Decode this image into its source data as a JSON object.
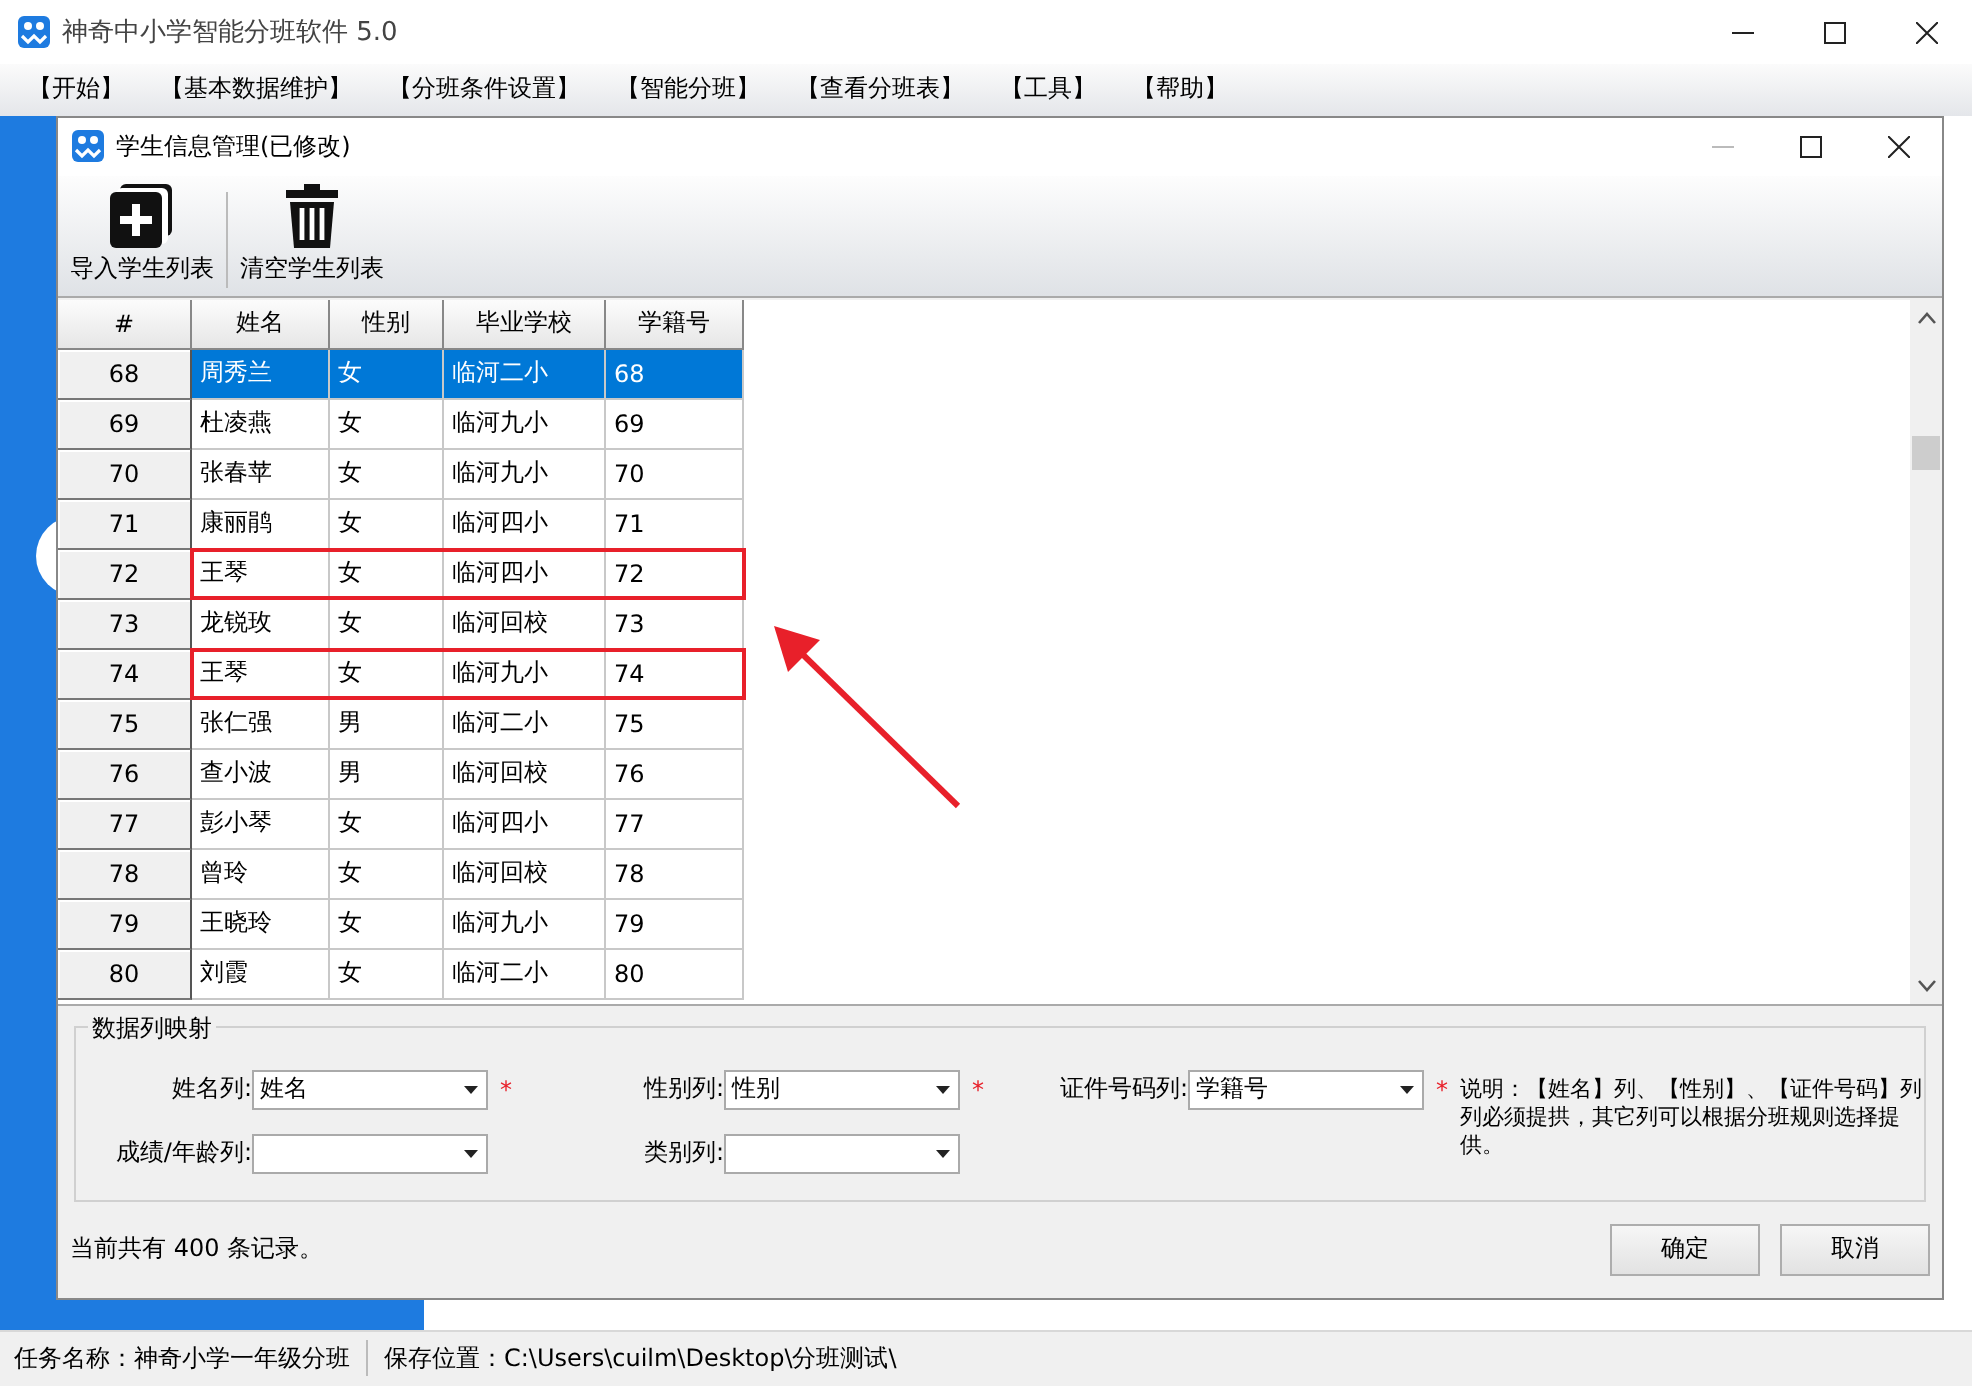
{
  "window": {
    "title": "神奇中小学智能分班软件 5.0"
  },
  "menu": [
    "【开始】",
    "【基本数据维护】",
    "【分班条件设置】",
    "【智能分班】",
    "【查看分班表】",
    "【工具】",
    "【帮助】"
  ],
  "dialog": {
    "title": "学生信息管理(已修改)",
    "toolbar": [
      {
        "kind": "import",
        "label": "导入学生列表"
      },
      {
        "kind": "clear",
        "label": "清空学生列表"
      }
    ],
    "table": {
      "columns": [
        "#",
        "姓名",
        "性别",
        "毕业学校",
        "学籍号"
      ],
      "rows": [
        {
          "cells": [
            "68",
            "周秀兰",
            "女",
            "临河二小",
            "68"
          ],
          "selected": true,
          "highlighted": false
        },
        {
          "cells": [
            "69",
            "杜凌燕",
            "女",
            "临河九小",
            "69"
          ],
          "selected": false,
          "highlighted": false
        },
        {
          "cells": [
            "70",
            "张春苹",
            "女",
            "临河九小",
            "70"
          ],
          "selected": false,
          "highlighted": false
        },
        {
          "cells": [
            "71",
            "康丽鹃",
            "女",
            "临河四小",
            "71"
          ],
          "selected": false,
          "highlighted": false
        },
        {
          "cells": [
            "72",
            "王琴",
            "女",
            "临河四小",
            "72"
          ],
          "selected": false,
          "highlighted": true
        },
        {
          "cells": [
            "73",
            "龙锐玫",
            "女",
            "临河回校",
            "73"
          ],
          "selected": false,
          "highlighted": false
        },
        {
          "cells": [
            "74",
            "王琴",
            "女",
            "临河九小",
            "74"
          ],
          "selected": false,
          "highlighted": true
        },
        {
          "cells": [
            "75",
            "张仁强",
            "男",
            "临河二小",
            "75"
          ],
          "selected": false,
          "highlighted": false
        },
        {
          "cells": [
            "76",
            "查小波",
            "男",
            "临河回校",
            "76"
          ],
          "selected": false,
          "highlighted": false
        },
        {
          "cells": [
            "77",
            "彭小琴",
            "女",
            "临河四小",
            "77"
          ],
          "selected": false,
          "highlighted": false
        },
        {
          "cells": [
            "78",
            "曾玲",
            "女",
            "临河回校",
            "78"
          ],
          "selected": false,
          "highlighted": false
        },
        {
          "cells": [
            "79",
            "王晓玲",
            "女",
            "临河九小",
            "79"
          ],
          "selected": false,
          "highlighted": false
        },
        {
          "cells": [
            "80",
            "刘霞",
            "女",
            "临河二小",
            "80"
          ],
          "selected": false,
          "highlighted": false
        }
      ]
    },
    "mapping": {
      "legend": "数据列映射",
      "fields": [
        {
          "label": "姓名列:",
          "value": "姓名",
          "required_mark": "*"
        },
        {
          "label": "性别列:",
          "value": "性别",
          "required_mark": "*"
        },
        {
          "label": "证件号码列:",
          "value": "学籍号",
          "required_mark": "*"
        },
        {
          "label": "成绩/年龄列:"
        },
        {
          "label": "类别列:"
        }
      ],
      "note": "说明：【姓名】列、【性别】、【证件号码】列列必须提拱，其它列可以根据分班规则选择提供。"
    },
    "record_count": "当前共有 400 条记录。",
    "buttons": [
      "确定",
      "取消"
    ]
  },
  "status_bar": [
    "任务名称：神奇小学一年级分班",
    "保存位置：C:\\Users\\cuilm\\Desktop\\分班测试\\"
  ]
}
